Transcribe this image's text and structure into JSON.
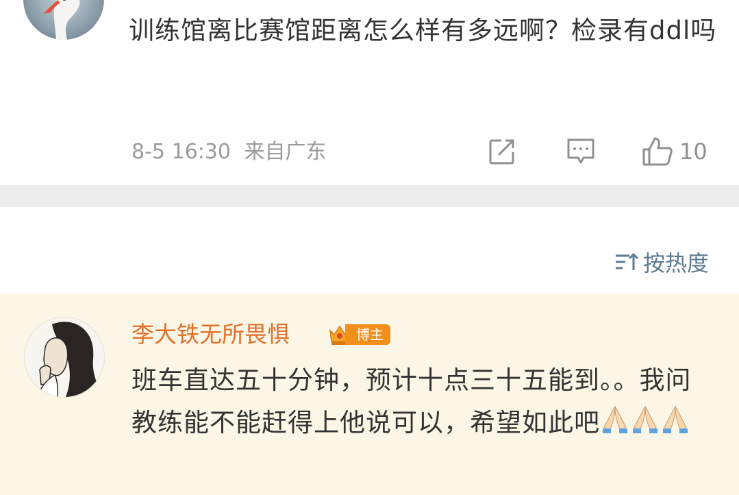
{
  "post": {
    "text": "训练馆离比赛馆距离怎么样有多远啊？检录有ddl吗",
    "time": "8-5 16:30",
    "location": "来自广东",
    "like_count": "10",
    "icons": [
      "share-icon",
      "comment-icon",
      "thumbs-up-icon"
    ]
  },
  "sort": {
    "label": "按热度",
    "icon": "sort-icon"
  },
  "comment": {
    "username": "李大铁无所畏惧",
    "badge": "博主",
    "badge_icon": "crown-badge-icon",
    "text": "班车直达五十分钟，预计十点三十五能到。。我问教练能不能赶得上他说可以，希望如此吧",
    "emoji": "🙏🙏🙏",
    "colors": {
      "username": "#e2702b",
      "badge": "#f08f1c",
      "highlight_bg": "#fbf6e5",
      "sort_label": "#5b7a92"
    }
  }
}
